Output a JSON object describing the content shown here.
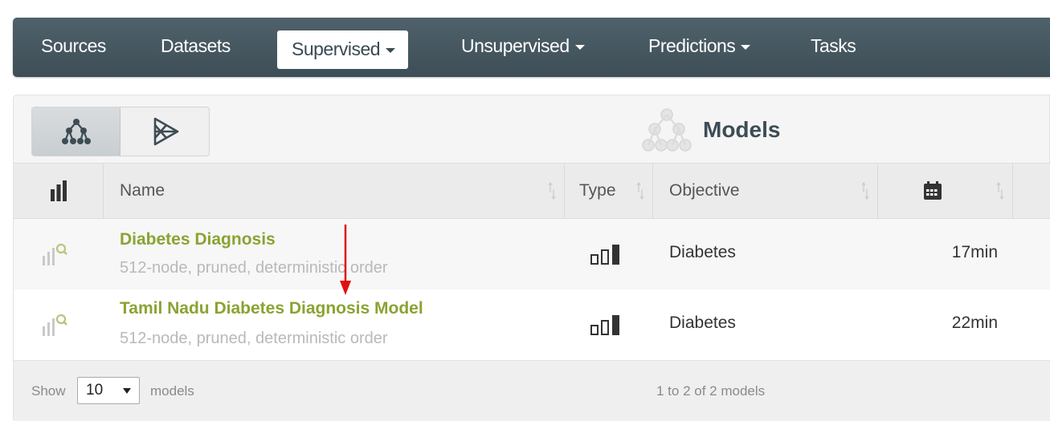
{
  "nav": {
    "items": [
      {
        "label": "Sources",
        "dropdown": false
      },
      {
        "label": "Datasets",
        "dropdown": false
      },
      {
        "label": "Supervised",
        "dropdown": true,
        "active": true
      },
      {
        "label": "Unsupervised",
        "dropdown": true
      },
      {
        "label": "Predictions",
        "dropdown": true
      },
      {
        "label": "Tasks",
        "dropdown": false
      }
    ]
  },
  "panel": {
    "title": "Models",
    "title_icon": "tree-model-icon",
    "view_toggle": [
      "tree-model-icon",
      "ensemble-icon"
    ]
  },
  "table": {
    "columns": [
      {
        "label": "",
        "icon": "bar-chart-icon"
      },
      {
        "label": "Name"
      },
      {
        "label": "Type"
      },
      {
        "label": "Objective"
      },
      {
        "label": "",
        "icon": "calendar-icon"
      }
    ],
    "rows": [
      {
        "name": "Diabetes Diagnosis",
        "description": "512-node, pruned, deterministic order",
        "type_icon": "classification-icon",
        "objective": "Diabetes",
        "age": "17min"
      },
      {
        "name": "Tamil Nadu Diabetes Diagnosis Model",
        "description": "512-node, pruned, deterministic order",
        "type_icon": "classification-icon",
        "objective": "Diabetes",
        "age": "22min"
      }
    ]
  },
  "footer": {
    "show_label": "Show",
    "page_size": "10",
    "models_label": "models",
    "summary": "1 to 2 of 2 models"
  },
  "colors": {
    "nav_bg": "#45565f",
    "model_link": "#8aa332",
    "annotation": "#e01010"
  }
}
